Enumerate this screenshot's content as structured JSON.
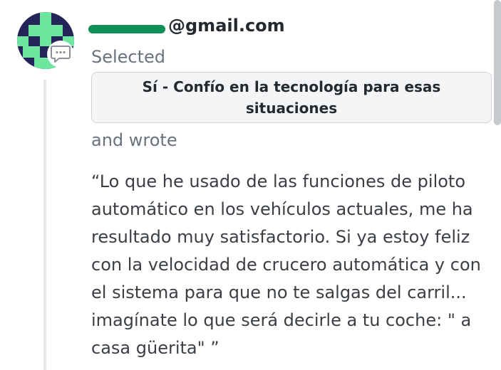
{
  "author": {
    "email_suffix": "@gmail.com"
  },
  "vote": {
    "selected_label": "Selected",
    "choice": "Sí - Confío en la tecnología para esas situaciones"
  },
  "comment": {
    "wrote_label": "and wrote",
    "lines": [
      "“Lo que he usado de las funciones de piloto",
      "automático en los vehículos actuales, me ha",
      "resultado muy satisfactorio. Si ya estoy feliz",
      "con la velocidad de crucero automática y con",
      "el sistema para que no te salgas del carril...",
      "imagínate lo que será decirle a tu coche: \" a",
      "casa güerita\" ”"
    ]
  },
  "icons": {
    "comment_badge": "comment-bubble-icon",
    "avatar": "identicon"
  },
  "colors": {
    "avatar_bg": "#24245a",
    "avatar_fg": "#6ee6a0",
    "redaction": "#0f8f55",
    "muted_text": "#6a737d"
  }
}
